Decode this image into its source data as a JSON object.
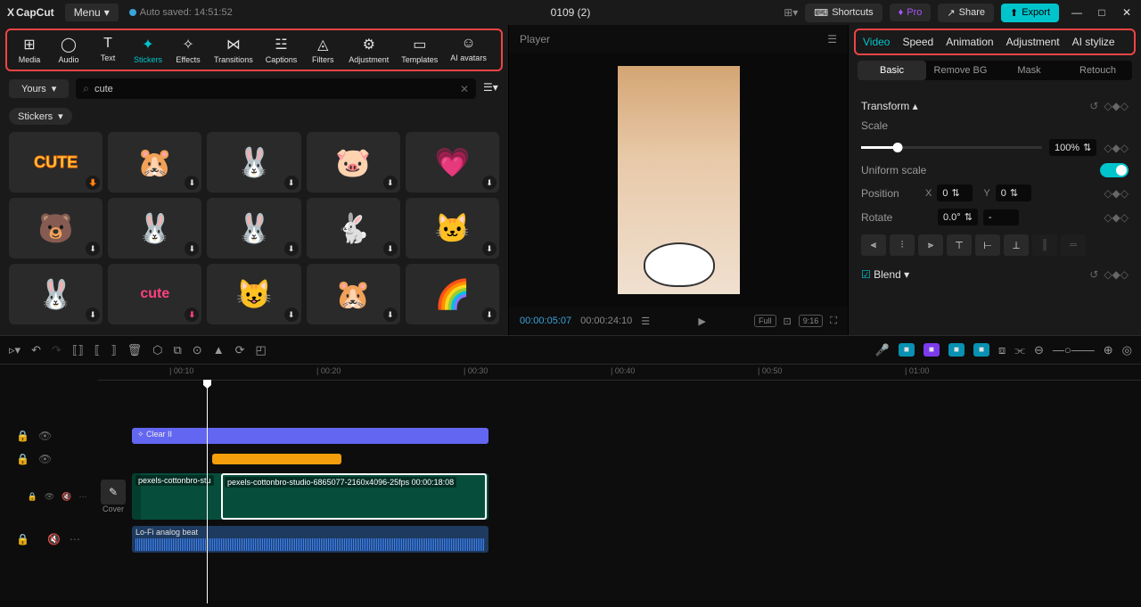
{
  "titlebar": {
    "logo": "CapCut",
    "menu": "Menu",
    "autosave": "Auto saved: 14:51:52",
    "project": "0109 (2)",
    "shortcuts": "Shortcuts",
    "pro": "Pro",
    "share": "Share",
    "export": "Export"
  },
  "toolbar": [
    {
      "label": "Media",
      "icon": "⊞"
    },
    {
      "label": "Audio",
      "icon": "◯"
    },
    {
      "label": "Text",
      "icon": "T"
    },
    {
      "label": "Stickers",
      "icon": "✦",
      "active": true
    },
    {
      "label": "Effects",
      "icon": "✧"
    },
    {
      "label": "Transitions",
      "icon": "⋈"
    },
    {
      "label": "Captions",
      "icon": "☳"
    },
    {
      "label": "Filters",
      "icon": "◬"
    },
    {
      "label": "Adjustment",
      "icon": "⚙"
    },
    {
      "label": "Templates",
      "icon": "▭"
    },
    {
      "label": "AI avatars",
      "icon": "☺"
    }
  ],
  "library": {
    "yours": "Yours",
    "search": "cute",
    "tag": "Stickers"
  },
  "player": {
    "title": "Player",
    "current": "00:00:05:07",
    "total": "00:00:24:10",
    "ratio": "9:16",
    "full": "Full"
  },
  "props": {
    "tabs": [
      "Video",
      "Speed",
      "Animation",
      "Adjustment",
      "AI stylize"
    ],
    "subtabs": [
      "Basic",
      "Remove BG",
      "Mask",
      "Retouch"
    ],
    "transform": "Transform",
    "scale": "Scale",
    "scale_val": "100%",
    "uniform": "Uniform scale",
    "position": "Position",
    "x": "X",
    "x_val": "0",
    "y": "Y",
    "y_val": "0",
    "rotate": "Rotate",
    "rotate_val": "0.0°",
    "blend": "Blend"
  },
  "timeline": {
    "marks": [
      "00:10",
      "00:20",
      "00:30",
      "00:40",
      "00:50",
      "01:00"
    ],
    "effect_clip": "Clear II",
    "vclip1": "pexels-cottonbro-stu",
    "vclip2": "pexels-cottonbro-studio-6865077-2160x4096-25fps  00:00:18:08",
    "audio": "Lo-Fi analog beat",
    "cover": "Cover"
  }
}
